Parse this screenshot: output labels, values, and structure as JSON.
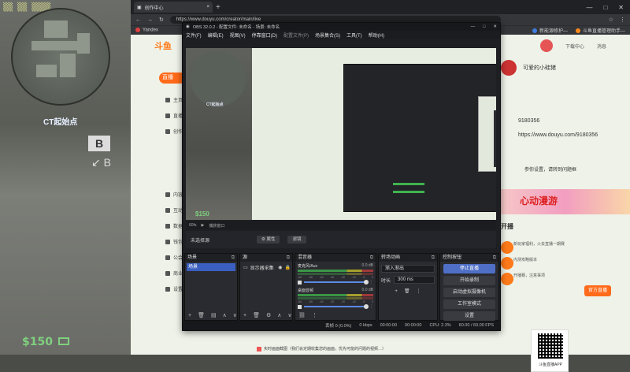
{
  "game": {
    "ct_label": "CT起始点",
    "money": "$150",
    "b_sign": "B",
    "arrow": "↙ B",
    "hud_left": "▒▒ ▒▒ ▒▒▒▒"
  },
  "browser": {
    "tab_title": "创作中心",
    "tab_close": "×",
    "tab_add": "+",
    "win_min": "—",
    "win_max": "□",
    "win_close": "✕",
    "url": "https://www.douyu.com/creator/main/live",
    "bookmarks": [
      "Yandex",
      "新能源修护—",
      "斗鱼直播管理助手—"
    ]
  },
  "page": {
    "logo": "斗鱼",
    "header_right": [
      "下载中心",
      "消息"
    ],
    "side_active": "直播",
    "side_items": [
      "主页",
      "直播",
      "创作",
      "内容",
      "互动",
      "数据",
      "钱包",
      "公会",
      "商业",
      "设置"
    ],
    "profile_name": "可爱的小硅猪",
    "profile_id": "9180356",
    "profile_url": "https://www.douyu.com/9180356",
    "profile_note": "参你设置，请转到问题框",
    "banner_text": "心动漫游",
    "open_live": "开播",
    "right_notes": [
      "新玩家福利，火去直播一期赛",
      "内测攻略版本",
      "开播赛，注意事项"
    ],
    "live_button": "官方直播",
    "qr_caption": "斗鱼直播APP",
    "bottom_check": "实时画面截图（我们会定期收集您的画面，优先可能的问题的视频…）"
  },
  "obs": {
    "title": "OBS 32.0.2 - 配置文件: 未命名 - 场景: 未命名",
    "menu": [
      "文件(F)",
      "编辑(E)",
      "视图(V)",
      "停靠窗口(D)",
      "配置文件(P)",
      "场景集合(S)",
      "工具(T)",
      "帮助(H)"
    ],
    "subbar": [
      "60fs",
      "▶",
      "捕获窗口"
    ],
    "no_source": "未选择源",
    "props_btn": "⚙ 属性",
    "filter_btn": "滤镜",
    "docks": {
      "scenes": {
        "title": "场景",
        "selected": "场景"
      },
      "sources": {
        "title": "源",
        "item": "显示器采集"
      },
      "mixer": {
        "title": "混音器",
        "tracks": [
          {
            "name": "麦克风/Aux",
            "db": "0.0 dB"
          },
          {
            "name": "桌面音频",
            "db": "0.0 dB"
          }
        ],
        "scale": [
          "-60",
          "-50",
          "-40",
          "-30",
          "-20",
          "-10",
          "-5",
          "0"
        ]
      },
      "transitions": {
        "title": "转场动画",
        "type": "渐入渐出",
        "duration_label": "时长",
        "duration": "300 ms"
      },
      "controls": {
        "title": "控制按钮",
        "buttons": [
          "停止直播",
          "开始录制",
          "启动虚拟摄像机",
          "工作室模式",
          "设置"
        ]
      }
    },
    "status": {
      "dropped": "丢帧 0 (0.0%)",
      "bitrate": "0 kbps",
      "live_time": "00:00:00",
      "rec_time": "00:00:00",
      "cpu": "CPU: 2.3%",
      "fps": "60.00 / 60.00 FPS"
    }
  }
}
